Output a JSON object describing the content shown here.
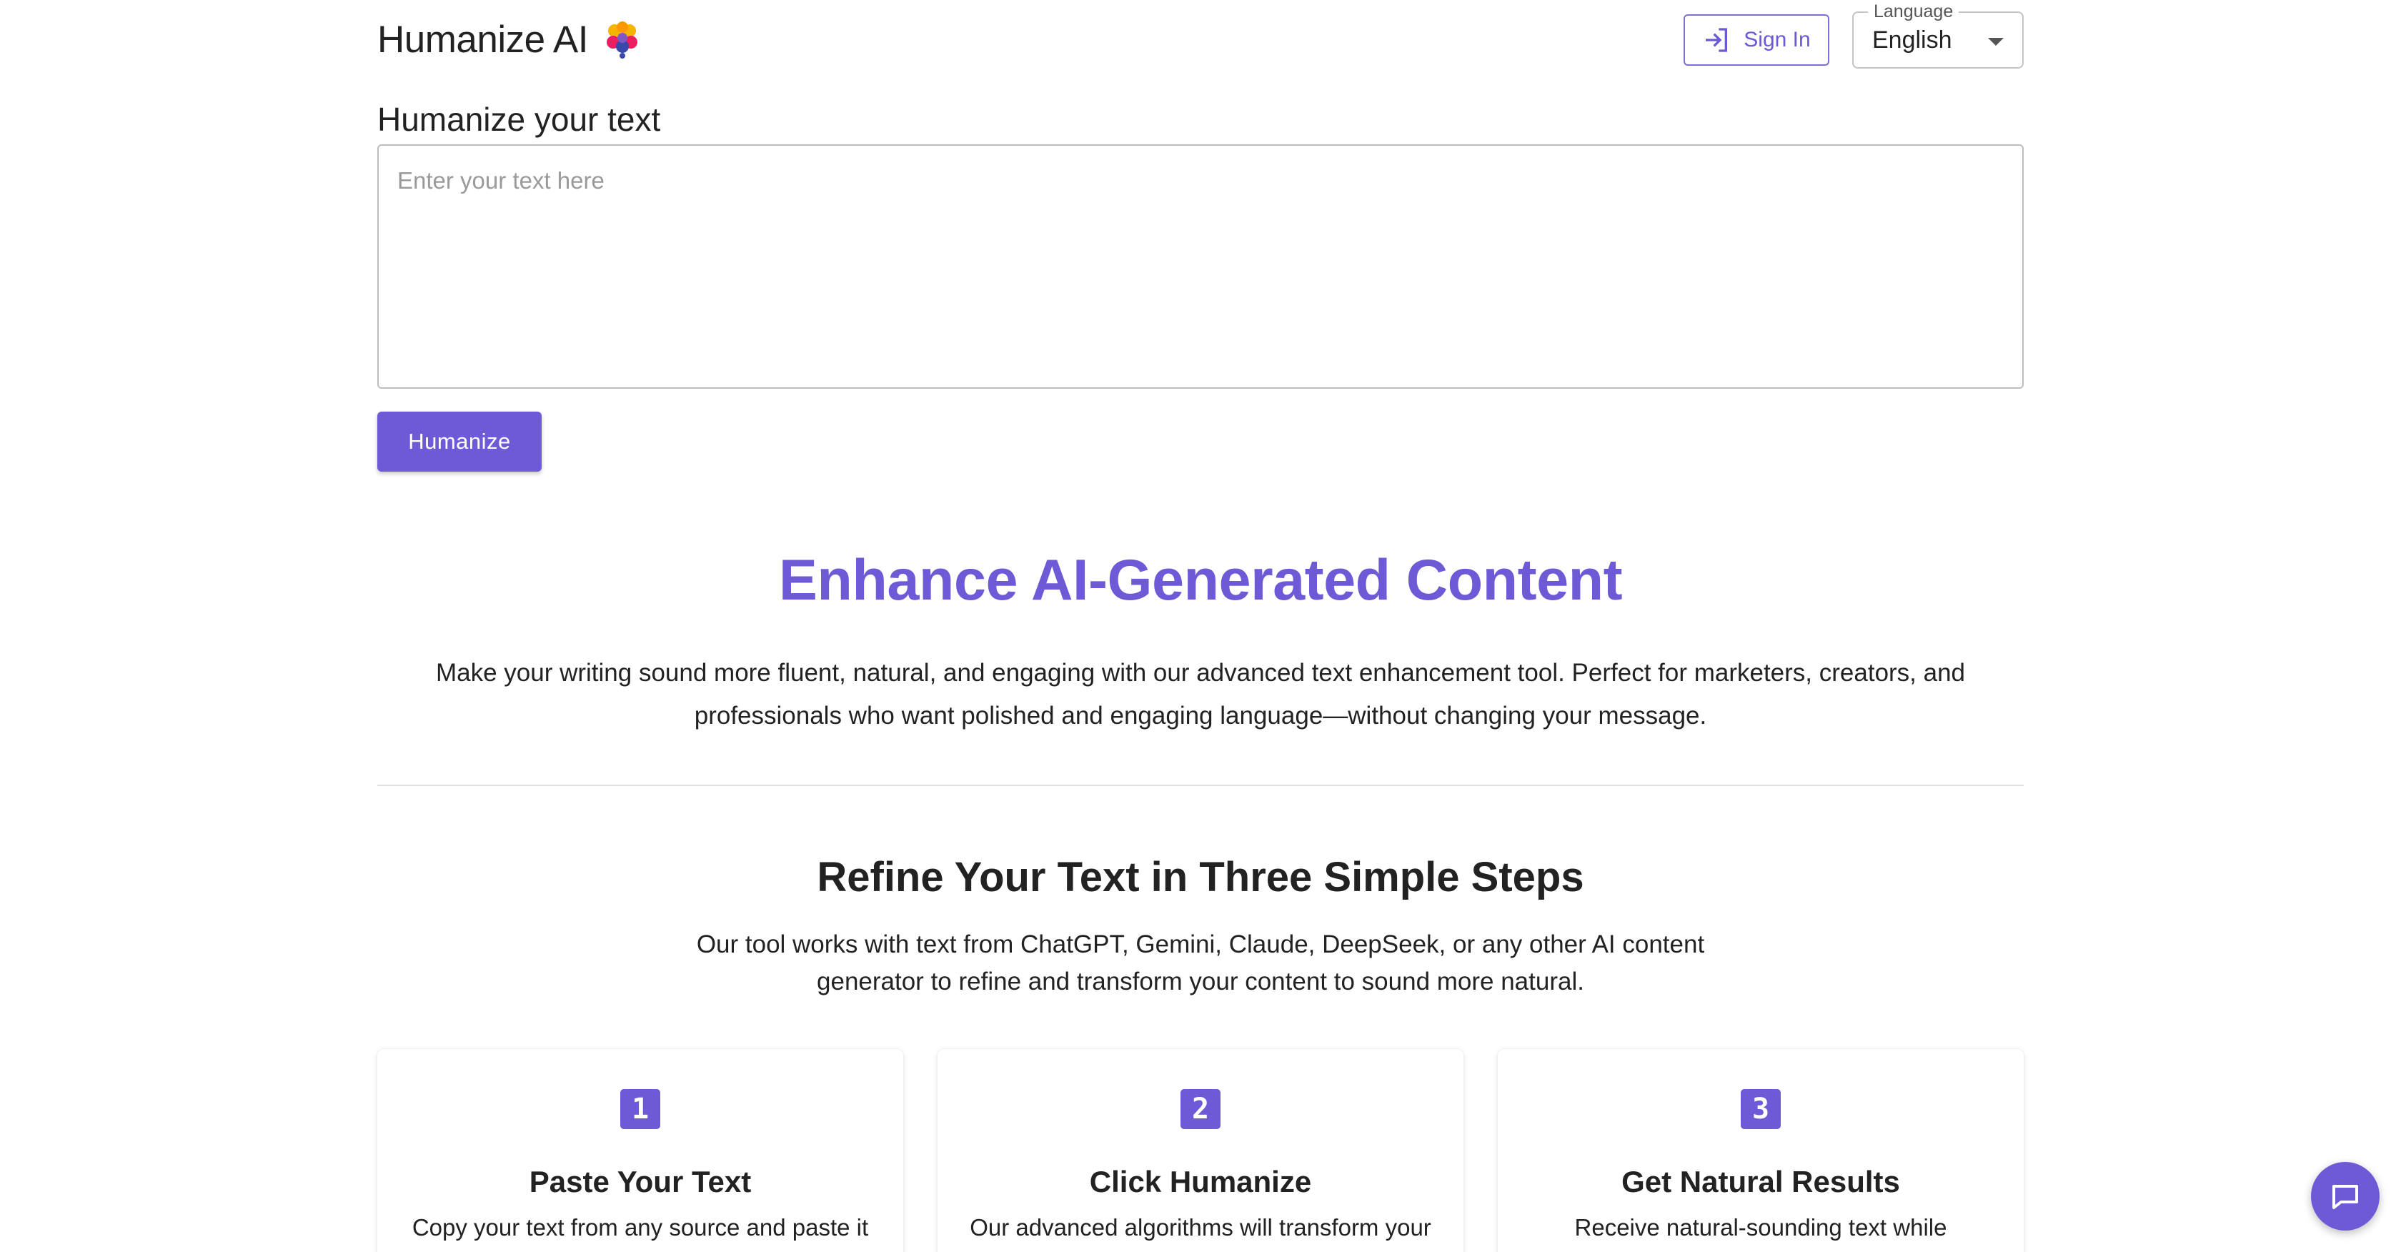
{
  "header": {
    "brand_name": "Humanize AI",
    "sign_in_label": "Sign In",
    "language": {
      "legend": "Language",
      "selected": "English"
    }
  },
  "humanize": {
    "label": "Humanize your text",
    "input_placeholder": "Enter your text here",
    "input_value": "",
    "button_label": "Humanize"
  },
  "hero": {
    "title": "Enhance AI-Generated Content",
    "description": "Make your writing sound more fluent, natural, and engaging with our advanced text enhancement tool. Perfect for marketers, creators, and professionals who want polished and engaging language—without changing your message."
  },
  "steps": {
    "title": "Refine Your Text in Three Simple Steps",
    "description": "Our tool works with text from ChatGPT, Gemini, Claude, DeepSeek, or any other AI content generator to refine and transform your content to sound more natural.",
    "items": [
      {
        "number": "1",
        "title": "Paste Your Text",
        "text": "Copy your text from any source and paste it"
      },
      {
        "number": "2",
        "title": "Click Humanize",
        "text": "Our advanced algorithms will transform your"
      },
      {
        "number": "3",
        "title": "Get Natural Results",
        "text": "Receive natural-sounding text while"
      }
    ]
  },
  "colors": {
    "accent": "#6e59d6",
    "text": "#222222",
    "border": "#bdbdbd"
  },
  "icons": {
    "brand_logo": "colorful-flower-logo",
    "sign_in": "login-arrow-icon",
    "language_caret": "caret-down-icon",
    "chat": "chat-bubble-icon"
  }
}
